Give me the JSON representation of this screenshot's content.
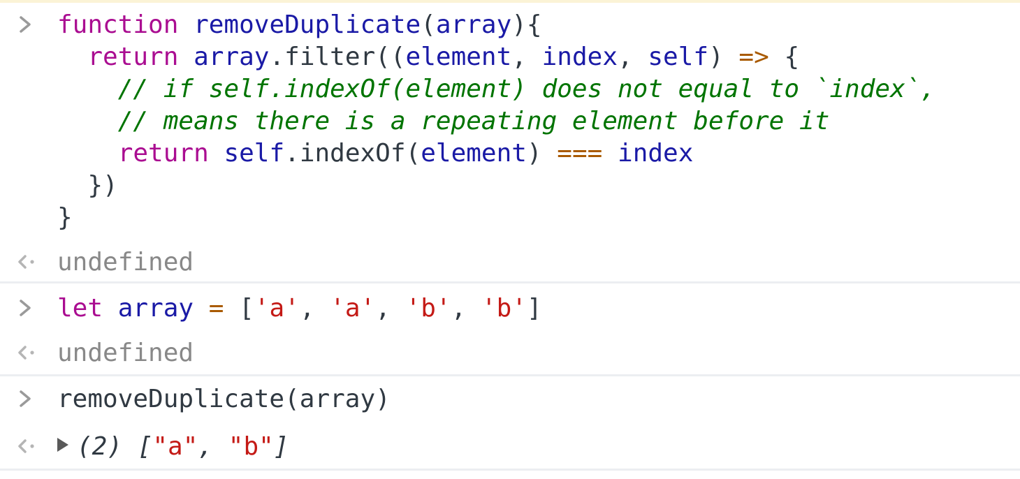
{
  "console": {
    "entries": [
      {
        "type": "input",
        "lines": [
          [
            {
              "t": "function",
              "c": "kw"
            },
            {
              "t": " ",
              "c": "plain"
            },
            {
              "t": "removeDuplicate",
              "c": "var"
            },
            {
              "t": "(",
              "c": "plain"
            },
            {
              "t": "array",
              "c": "var"
            },
            {
              "t": "){",
              "c": "plain"
            }
          ],
          [
            {
              "t": "  ",
              "c": "plain"
            },
            {
              "t": "return",
              "c": "kw"
            },
            {
              "t": " ",
              "c": "plain"
            },
            {
              "t": "array",
              "c": "var"
            },
            {
              "t": ".filter((",
              "c": "plain"
            },
            {
              "t": "element",
              "c": "var"
            },
            {
              "t": ", ",
              "c": "plain"
            },
            {
              "t": "index",
              "c": "var"
            },
            {
              "t": ", ",
              "c": "plain"
            },
            {
              "t": "self",
              "c": "var"
            },
            {
              "t": ") ",
              "c": "plain"
            },
            {
              "t": "=>",
              "c": "op"
            },
            {
              "t": " {",
              "c": "plain"
            }
          ],
          [
            {
              "t": "    ",
              "c": "plain"
            },
            {
              "t": "// if self.indexOf(element) does not equal to `index`,",
              "c": "cmt"
            }
          ],
          [
            {
              "t": "    ",
              "c": "plain"
            },
            {
              "t": "// means there is a repeating element before it",
              "c": "cmt"
            }
          ],
          [
            {
              "t": "    ",
              "c": "plain"
            },
            {
              "t": "return",
              "c": "kw"
            },
            {
              "t": " ",
              "c": "plain"
            },
            {
              "t": "self",
              "c": "var"
            },
            {
              "t": ".indexOf(",
              "c": "plain"
            },
            {
              "t": "element",
              "c": "var"
            },
            {
              "t": ") ",
              "c": "plain"
            },
            {
              "t": "===",
              "c": "op"
            },
            {
              "t": " ",
              "c": "plain"
            },
            {
              "t": "index",
              "c": "var"
            }
          ],
          [
            {
              "t": "  })",
              "c": "plain"
            }
          ],
          [
            {
              "t": "}",
              "c": "plain"
            }
          ]
        ]
      },
      {
        "type": "output",
        "lines": [
          [
            {
              "t": "undefined",
              "c": "gray"
            }
          ]
        ]
      },
      {
        "type": "input",
        "lines": [
          [
            {
              "t": "let",
              "c": "kw"
            },
            {
              "t": " ",
              "c": "plain"
            },
            {
              "t": "array",
              "c": "var"
            },
            {
              "t": " ",
              "c": "plain"
            },
            {
              "t": "=",
              "c": "op"
            },
            {
              "t": " [",
              "c": "plain"
            },
            {
              "t": "'a'",
              "c": "str"
            },
            {
              "t": ", ",
              "c": "plain"
            },
            {
              "t": "'a'",
              "c": "str"
            },
            {
              "t": ", ",
              "c": "plain"
            },
            {
              "t": "'b'",
              "c": "str"
            },
            {
              "t": ", ",
              "c": "plain"
            },
            {
              "t": "'b'",
              "c": "str"
            },
            {
              "t": "]",
              "c": "plain"
            }
          ]
        ]
      },
      {
        "type": "output",
        "lines": [
          [
            {
              "t": "undefined",
              "c": "gray"
            }
          ]
        ]
      },
      {
        "type": "input",
        "lines": [
          [
            {
              "t": "removeDuplicate(array)",
              "c": "plain"
            }
          ]
        ]
      },
      {
        "type": "output-array",
        "lines": [
          [
            {
              "t": "(2) [",
              "c": "result-italic"
            },
            {
              "t": "\"a\"",
              "c": "str"
            },
            {
              "t": ", ",
              "c": "result-italic"
            },
            {
              "t": "\"b\"",
              "c": "str"
            },
            {
              "t": "]",
              "c": "result-italic"
            }
          ]
        ]
      }
    ]
  },
  "icons": {
    "input_prompt": "chevron-right-icon",
    "output_prompt": "return-arrow-icon",
    "expand": "disclosure-triangle-icon"
  },
  "colors": {
    "keyword": "#aa0d91",
    "variable": "#1a1aa6",
    "operator": "#a95a00",
    "string": "#c41a16",
    "comment": "#007400",
    "muted": "#888888"
  }
}
